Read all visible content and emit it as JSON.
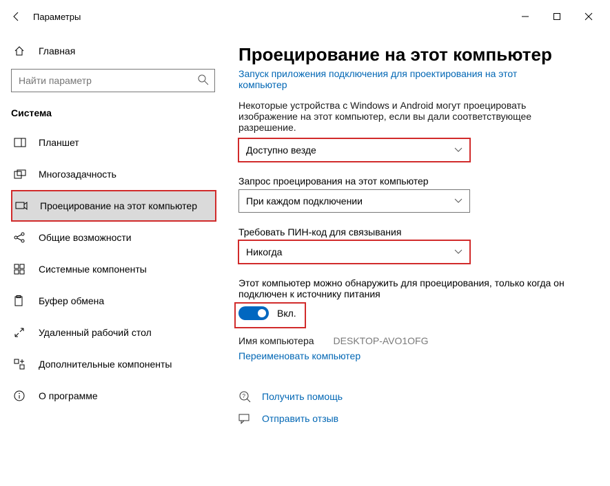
{
  "window": {
    "title": "Параметры"
  },
  "sidebar": {
    "home": "Главная",
    "search_placeholder": "Найти параметр",
    "section": "Система",
    "items": [
      {
        "label": "Планшет"
      },
      {
        "label": "Многозадачность"
      },
      {
        "label": "Проецирование на этот компьютер"
      },
      {
        "label": "Общие возможности"
      },
      {
        "label": "Системные компоненты"
      },
      {
        "label": "Буфер обмена"
      },
      {
        "label": "Удаленный рабочий стол"
      },
      {
        "label": "Дополнительные компоненты"
      },
      {
        "label": "О программе"
      }
    ]
  },
  "main": {
    "title": "Проецирование на этот компьютер",
    "launch_link": "Запуск приложения подключения для проектирования на этот компьютер",
    "desc": "Некоторые устройства с Windows и Android могут проецировать изображение на этот компьютер, если вы дали соответствующее разрешение.",
    "dropdown1": "Доступно везде",
    "label2": "Запрос проецирования на этот компьютер",
    "dropdown2": "При каждом подключении",
    "label3": "Требовать ПИН-код для связывания",
    "dropdown3": "Никогда",
    "label4": "Этот компьютер можно обнаружить для проецирования, только когда он подключен к источнику питания",
    "toggle_label": "Вкл.",
    "pc_name_label": "Имя компьютера",
    "pc_name_value": "DESKTOP-AVO1OFG",
    "rename_link": "Переименовать компьютер",
    "help_link": "Получить помощь",
    "feedback_link": "Отправить отзыв"
  }
}
